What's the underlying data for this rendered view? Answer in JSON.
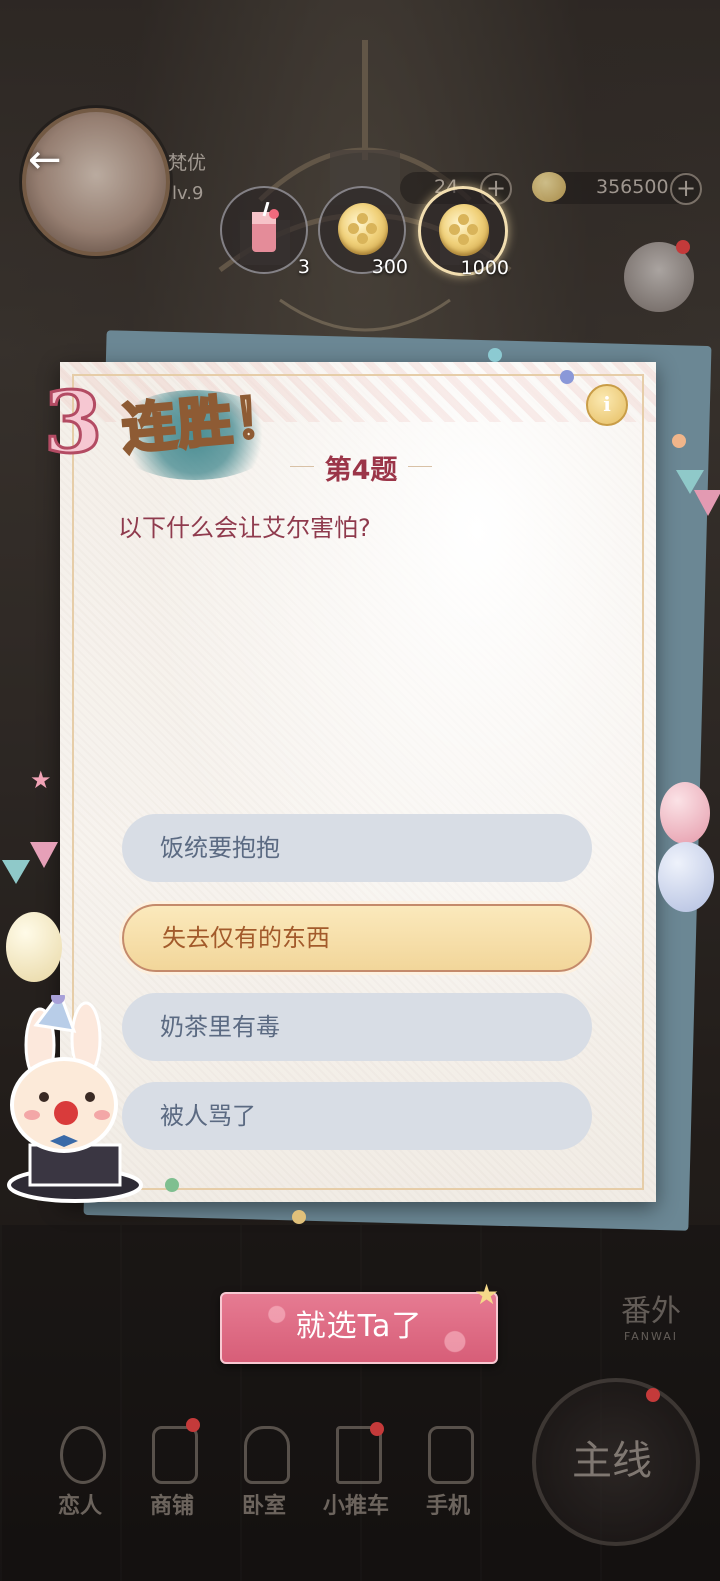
{
  "player": {
    "name": "梵优",
    "level": "lv.9",
    "currency_1": "24",
    "currency_2": "356500"
  },
  "rewards": [
    {
      "icon": "drink-icon",
      "count": "3"
    },
    {
      "icon": "gold-coin-icon",
      "count": "300"
    },
    {
      "icon": "gold-coin-icon",
      "count": "1000",
      "selected": true
    }
  ],
  "quiz": {
    "streak_number": "3",
    "streak_text": "连胜！",
    "info_label": "i",
    "question_number": "第4题",
    "question": "以下什么会让艾尔害怕?",
    "options": [
      {
        "label": "饭统要抱抱",
        "selected": false
      },
      {
        "label": "失去仅有的东西",
        "selected": true
      },
      {
        "label": "奶茶里有毒",
        "selected": false
      },
      {
        "label": "被人骂了",
        "selected": false
      }
    ],
    "confirm_label": "就选Ta了"
  },
  "side": {
    "fanwai_cn": "番外",
    "fanwai_en": "FANWAI"
  },
  "nav": {
    "items": [
      {
        "label": "恋人",
        "icon": "lover-icon"
      },
      {
        "label": "商铺",
        "icon": "shop-bag-icon"
      },
      {
        "label": "卧室",
        "icon": "bedroom-icon"
      },
      {
        "label": "小推车",
        "icon": "cart-icon"
      },
      {
        "label": "手机",
        "icon": "phone-icon"
      }
    ],
    "main_label": "主线"
  },
  "colors": {
    "accent_pink": "#d75e78",
    "question_red": "#9b3548",
    "option_blue": "#d8dde5",
    "option_selected": "#f2d69a"
  }
}
